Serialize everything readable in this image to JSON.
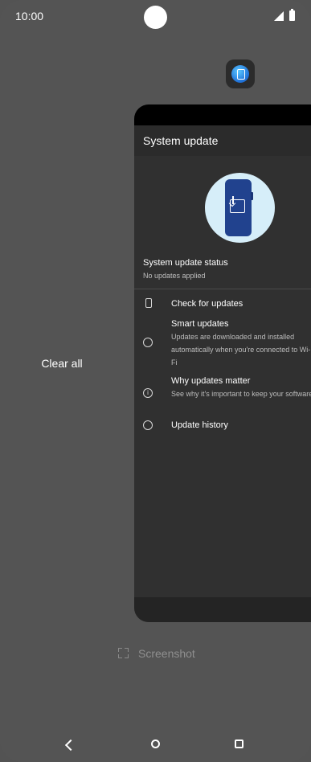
{
  "status_bar": {
    "time": "10:00",
    "icons": [
      "camera-cutout",
      "signal-icon",
      "battery-icon"
    ]
  },
  "recents": {
    "clear_all_label": "Clear all",
    "app_icon": "app-icon",
    "screenshot_label": "Screenshot"
  },
  "task_card": {
    "title": "System update",
    "hero_icon": "phone-download-icon",
    "status_title": "System update status",
    "status_value": "No updates applied",
    "items": [
      {
        "icon": "phone-check-icon",
        "title": "Check for updates",
        "desc": ""
      },
      {
        "icon": "refresh-icon",
        "title": "Smart updates",
        "desc": "Updates are downloaded and installed automatically when you're connected to Wi-Fi"
      },
      {
        "icon": "info-icon",
        "title": "Why updates matter",
        "desc": "See why it's important to keep your software up to date"
      },
      {
        "icon": "history-icon",
        "title": "Update history",
        "desc": ""
      }
    ]
  },
  "colors": {
    "background": "#545454",
    "card": "#303030",
    "hero_bg": "#d6eef9",
    "phone": "#21428e"
  },
  "nav": {
    "back": "back-icon",
    "home": "home-icon",
    "recents": "recents-icon"
  }
}
